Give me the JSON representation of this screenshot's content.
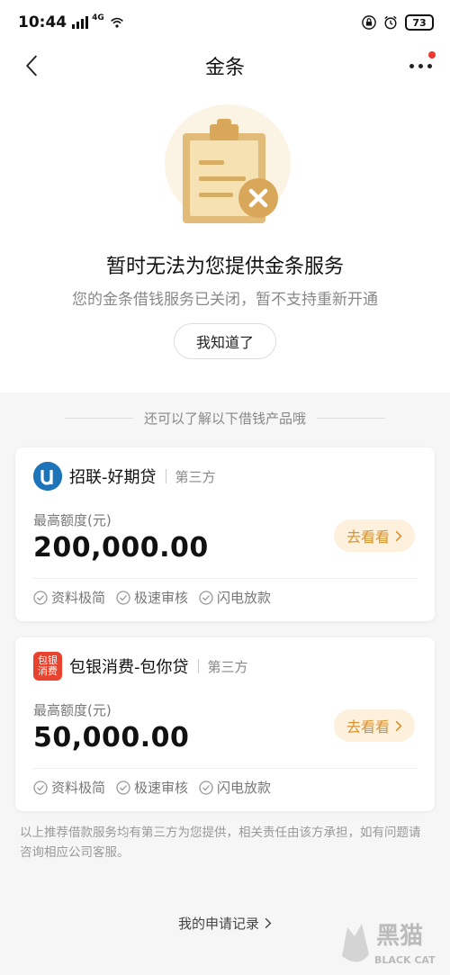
{
  "status_bar": {
    "time": "10:44",
    "network": "4G",
    "battery": "73"
  },
  "nav": {
    "title": "金条"
  },
  "notice": {
    "title": "暂时无法为您提供金条服务",
    "subtitle": "您的金条借钱服务已关闭，暂不支持重新开通",
    "button": "我知道了"
  },
  "section_divider": "还可以了解以下借钱产品哦",
  "products": [
    {
      "name": "招联-好期贷",
      "tag": "第三方",
      "limit_label": "最高额度(元)",
      "limit_value": "200,000.00",
      "button": "去看看",
      "features": [
        "资料极简",
        "极速审核",
        "闪电放款"
      ]
    },
    {
      "name": "包银消费-包你贷",
      "tag": "第三方",
      "logo_text": [
        "包银",
        "消费"
      ],
      "limit_label": "最高额度(元)",
      "limit_value": "50,000.00",
      "button": "去看看",
      "features": [
        "资料极简",
        "极速审核",
        "闪电放款"
      ]
    }
  ],
  "disclaimer": "以上推荐借款服务均有第三方为您提供，相关责任由该方承担，如有问题请咨询相应公司客服。",
  "records_link": "我的申请记录",
  "watermark": {
    "text_cn": "黑猫",
    "text_en": "BLACK CAT"
  },
  "colors": {
    "accent_gold": "#d9922c",
    "button_bg": "#fdf1dd",
    "badge_red": "#f0372e"
  },
  "icons": [
    "back-arrow-icon",
    "more-icon",
    "clipboard-error-icon",
    "check-circle-icon",
    "chevron-right-icon"
  ]
}
